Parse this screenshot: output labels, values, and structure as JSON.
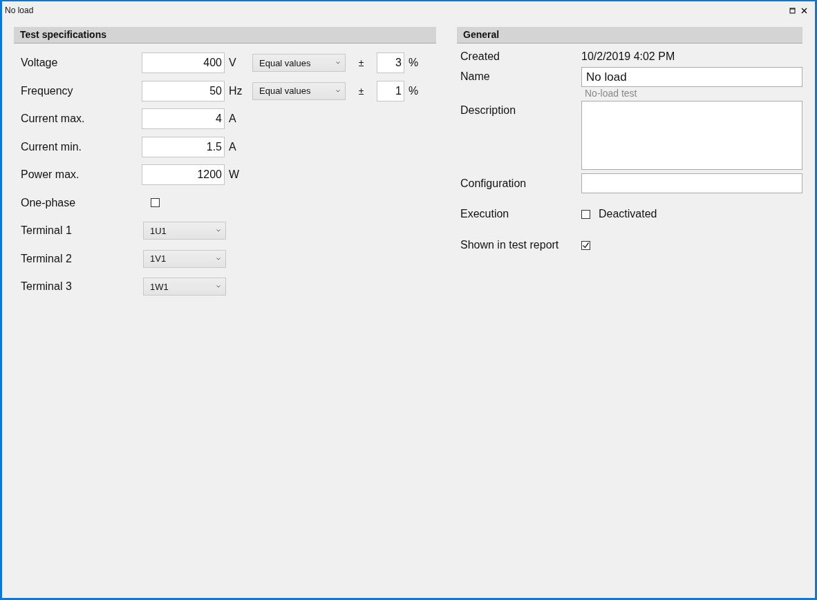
{
  "window": {
    "title": "No load"
  },
  "test_specs": {
    "title": "Test specifications",
    "rows": [
      {
        "kind": "value",
        "label": "Voltage",
        "value": "400",
        "unit": "V",
        "mode": "Equal values",
        "tolerance_sign": "±",
        "tolerance": "3",
        "tolerance_unit": "%"
      },
      {
        "kind": "value",
        "label": "Frequency",
        "value": "50",
        "unit": "Hz",
        "mode": "Equal values",
        "tolerance_sign": "±",
        "tolerance": "1",
        "tolerance_unit": "%"
      },
      {
        "kind": "value",
        "label": "Current max.",
        "value": "4",
        "unit": "A"
      },
      {
        "kind": "value",
        "label": "Current min.",
        "value": "1.5",
        "unit": "A"
      },
      {
        "kind": "value",
        "label": "Power max.",
        "value": "1200",
        "unit": "W"
      },
      {
        "kind": "checkbox",
        "label": "One-phase",
        "checked": false
      },
      {
        "kind": "select",
        "label": "Terminal 1",
        "value": "1U1"
      },
      {
        "kind": "select",
        "label": "Terminal 2",
        "value": "1V1"
      },
      {
        "kind": "select",
        "label": "Terminal 3",
        "value": "1W1"
      }
    ]
  },
  "general": {
    "title": "General",
    "created": {
      "label": "Created",
      "value": "10/2/2019 4:02 PM"
    },
    "name": {
      "label": "Name",
      "value": "No load",
      "hint": "No-load test"
    },
    "description": {
      "label": "Description"
    },
    "configuration": {
      "label": "Configuration"
    },
    "execution": {
      "label": "Execution",
      "checked": false,
      "text": "Deactivated"
    },
    "report": {
      "label": "Shown in test report",
      "checked": true
    }
  }
}
